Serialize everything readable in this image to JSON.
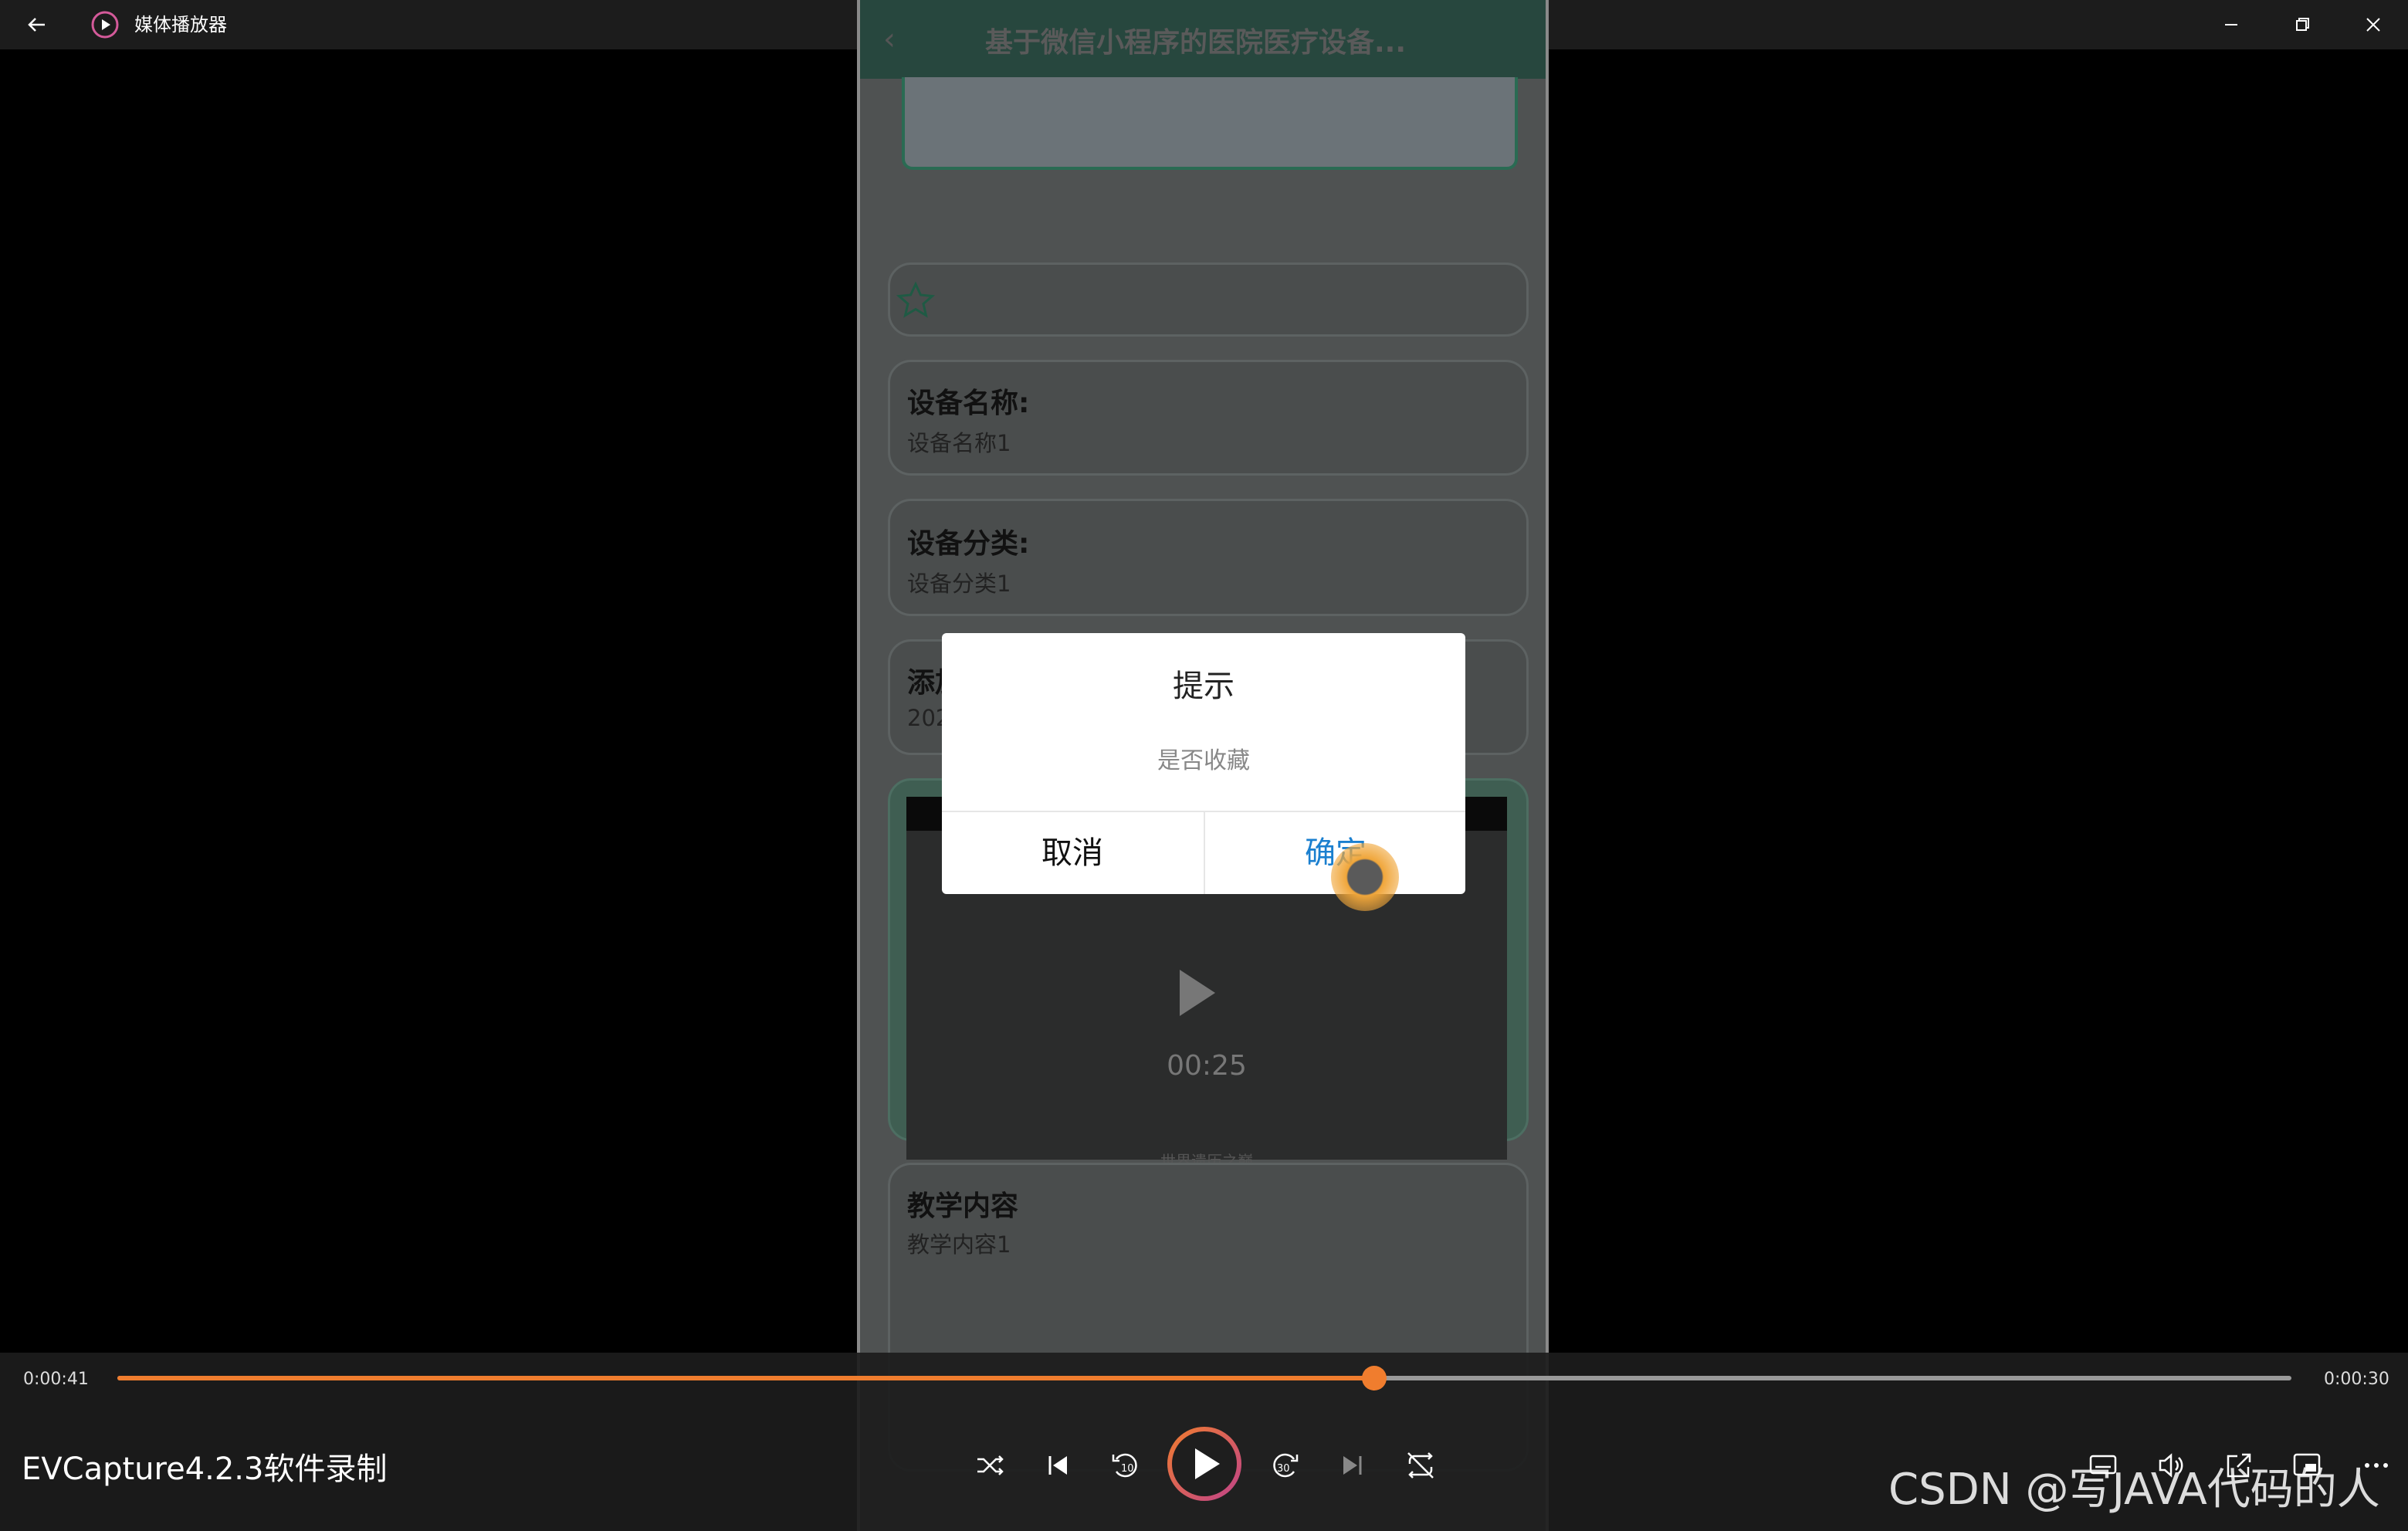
{
  "window": {
    "title": "媒体播放器",
    "back_icon": "arrow-left-icon",
    "app_icon": "media-player-icon",
    "controls": [
      "minimize-icon",
      "restore-icon",
      "close-icon"
    ]
  },
  "phone": {
    "header_title": "基于微信小程序的医院医疗设备...",
    "fields": [
      {
        "label": "设备名称:",
        "value": "设备名称1"
      },
      {
        "label": "设备分类:",
        "value": "设备分类1"
      },
      {
        "label": "添加",
        "value": "202"
      }
    ],
    "video": {
      "time": "00:25",
      "caption": "世界遗历之巅"
    },
    "content": {
      "label": "教学内容",
      "value": "教学内容1"
    }
  },
  "dialog": {
    "title": "提示",
    "message": "是否收藏",
    "cancel_label": "取消",
    "confirm_label": "确定"
  },
  "player": {
    "elapsed": "0:00:41",
    "remaining": "0:00:30",
    "progress_fraction": 0.578,
    "accent_color": "#f07d2e",
    "recording_label": "EVCapture4.2.3软件录制",
    "overlay_watermark": "CSDN @写JAVA代码的人"
  }
}
